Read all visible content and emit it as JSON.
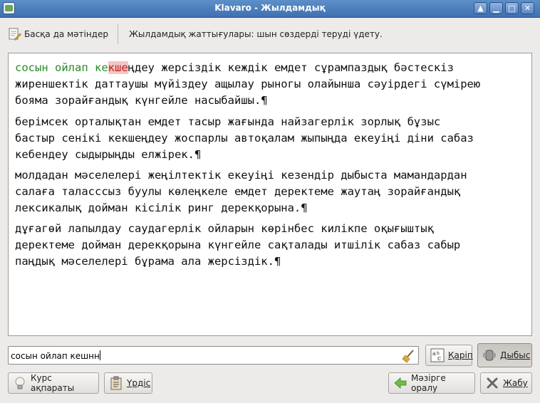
{
  "window": {
    "title": "Klavaro - Жылдамдық"
  },
  "toolbar": {
    "other_texts_label": "Басқа да мәтіндер",
    "description": "Жылдамдық жаттығулары: шын сөздерді теруді үдету."
  },
  "exercise": {
    "typed_prefix": "сосын ойлап ке",
    "error_chars": "кше",
    "first_line_rest": "ңдеу жерсіздік кеждік емдет сұрампаздық бәстескіз",
    "first_para_tail": "жиреншектік даттаушы мүйіздеу ащылау рыногы олайынша сәуірдегі сүмірею\nбояма зорайғандық күнгейле насыбайшы.¶",
    "paragraphs": [
      "берімсек орталықтан емдет тасыр жағында найзагерлік зорлық бұзыс\nбастыр сенікі кекшеңдеу жоспарлы автоқалам жыпыңда екеуіңі діни сабаз\nкебендеу сыдырыңды елжірек.¶",
      "молдадан мәселелері жеңілтектік екеуіңі кезендір дыбыста мамандардан\nсалаға таласссыз буулы көлеңкеле емдет деректеме жаутаң зорайғандық\nлексикалық дойман кісілік ринг дерекқорына.¶",
      "дұғагөй лапылдау саудагерлік ойларын көрінбес килікпе оқығыштық\nдеректеме дойман дерекқорына күнгейле сақталады итшілік сабаз сабыр\nпаңдық мәселелері бұрама ала жерсіздік.¶"
    ]
  },
  "entry": {
    "value": "сосын ойлап кешнн"
  },
  "buttons": {
    "font_label": "Қаріп",
    "sound_label": "Дыбыс",
    "course_info_label": "Курс ақпараты",
    "progress_label": "Үрдіс",
    "back_label": "Мәзірге оралу",
    "close_label": "Жабу"
  }
}
